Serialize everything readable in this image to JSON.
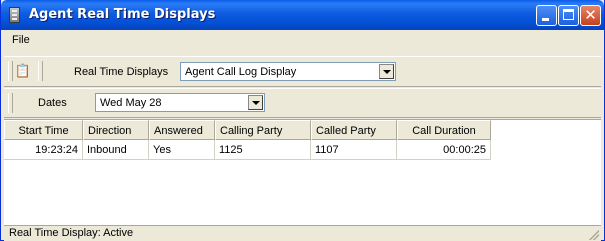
{
  "window": {
    "title": "Agent Real Time Displays"
  },
  "menu": {
    "file": "File"
  },
  "toolbar": {
    "real_time_displays_label": "Real Time Displays",
    "real_time_displays_selected": "Agent Call Log Display",
    "dates_label": "Dates",
    "dates_selected": "Wed May 28"
  },
  "grid": {
    "columns": [
      "Start Time",
      "Direction",
      "Answered",
      "Calling Party",
      "Called Party",
      "Call Duration"
    ],
    "rows": [
      [
        "19:23:24",
        "Inbound",
        "Yes",
        "1125",
        "1107",
        "00:00:25"
      ]
    ]
  },
  "status": {
    "text": "Real Time Display: Active"
  },
  "icons": {
    "app": "app-window-icon",
    "toolbar": "clipboard-icon"
  },
  "colors": {
    "titlebar": "#0451d8",
    "close_button": "#c6411e",
    "chrome": "#ece9d8"
  }
}
